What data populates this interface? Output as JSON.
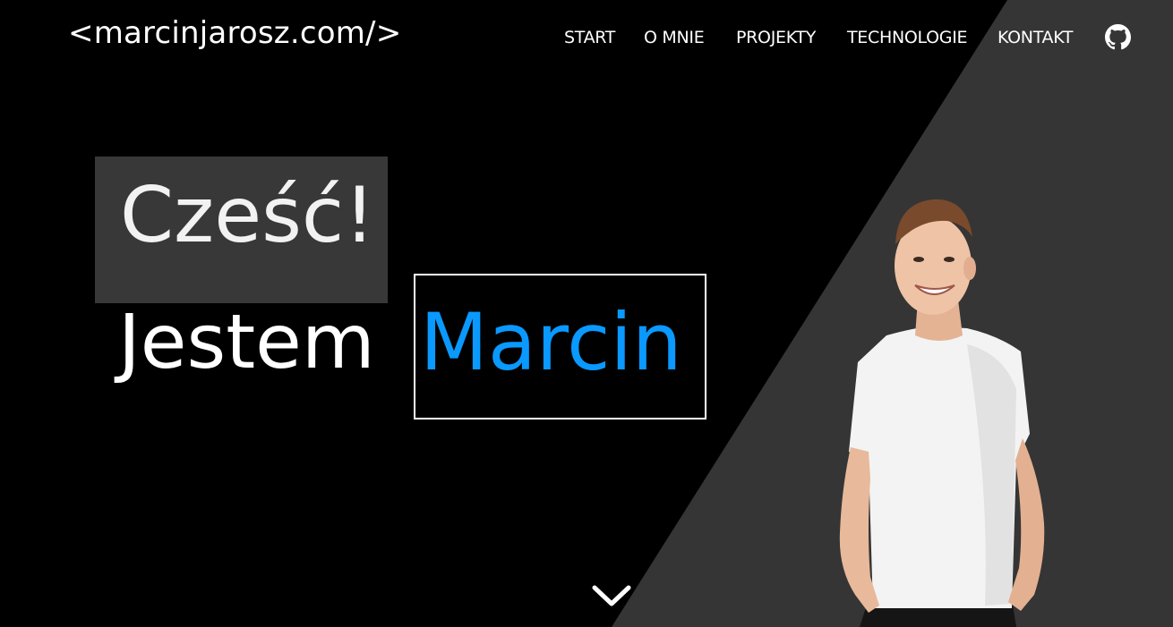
{
  "header": {
    "logo": "<marcinjarosz.com/>",
    "nav": [
      {
        "label": "START"
      },
      {
        "label": "O MNIE"
      },
      {
        "label": "PROJEKTY"
      },
      {
        "label": "TECHNOLOGIE"
      },
      {
        "label": "KONTAKT"
      }
    ],
    "github_icon": "github-icon"
  },
  "hero": {
    "greeting": "Cześć!",
    "intro": "Jestem",
    "name": "Marcin",
    "scroll_icon": "chevron-down-icon"
  },
  "colors": {
    "background": "#000000",
    "diagonal_panel": "#353535",
    "greeting_box": "#383838",
    "accent": "#0a99ff"
  }
}
